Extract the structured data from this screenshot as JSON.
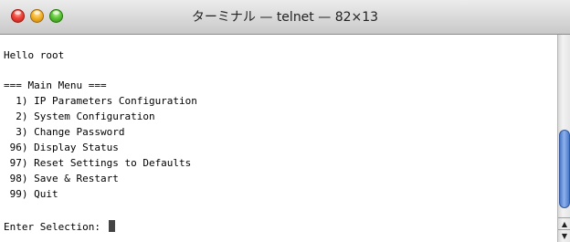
{
  "window": {
    "title": "ターミナル — telnet — 82×13"
  },
  "terminal": {
    "lines": [
      "Hello root",
      "",
      "=== Main Menu ===",
      "  1) IP Parameters Configuration",
      "  2) System Configuration",
      "  3) Change Password",
      " 96) Display Status",
      " 97) Reset Settings to Defaults",
      " 98) Save & Restart",
      " 99) Quit",
      "",
      "Enter Selection: "
    ]
  },
  "colors": {
    "terminal_background": "#ffffff",
    "terminal_text": "#000000",
    "scroll_thumb": "#5b8ad6"
  }
}
